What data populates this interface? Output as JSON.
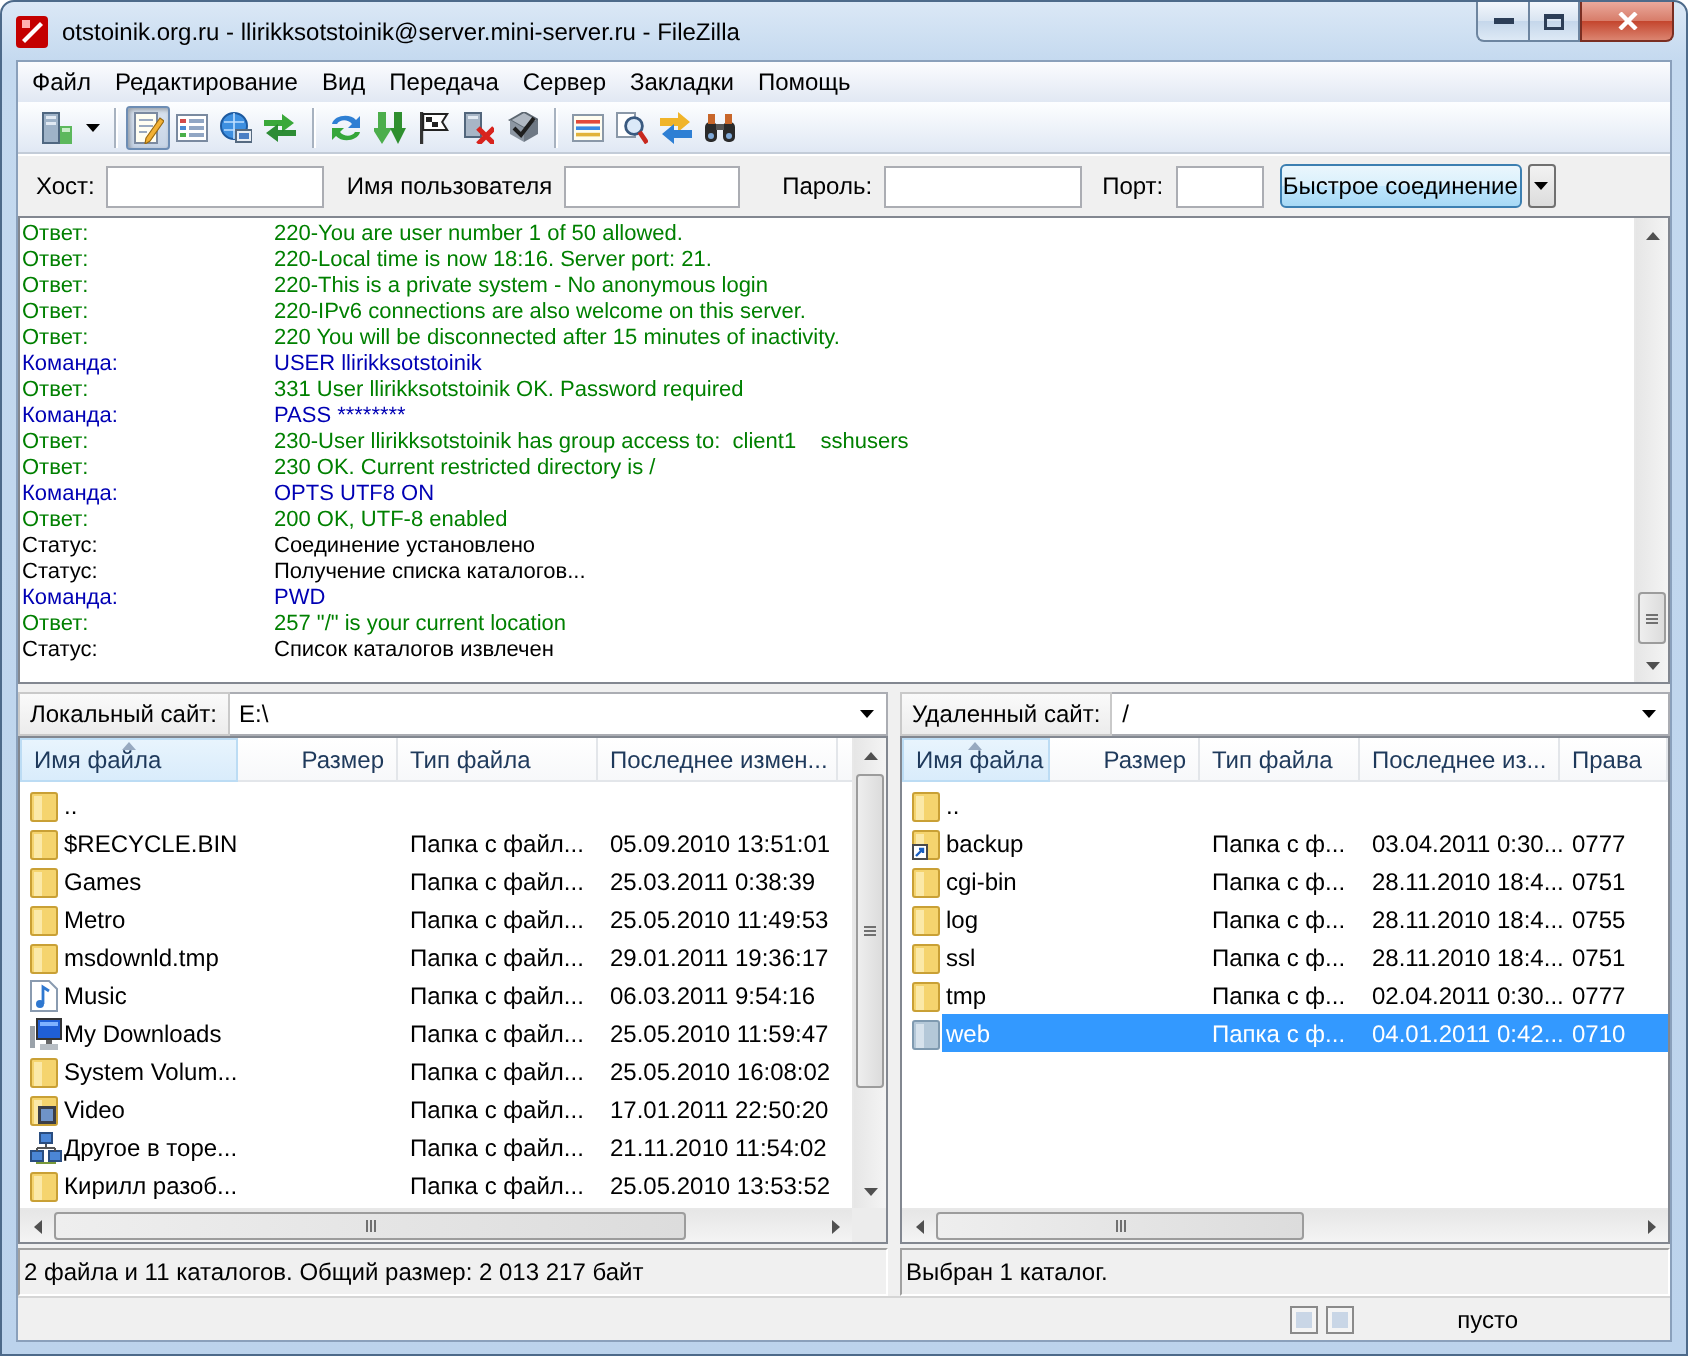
{
  "window": {
    "title": "otstoinik.org.ru - llirikksotstoinik@server.mini-server.ru - FileZilla"
  },
  "menu": [
    "Файл",
    "Редактирование",
    "Вид",
    "Передача",
    "Сервер",
    "Закладки",
    "Помощь"
  ],
  "toolbar": {
    "groups": [
      [
        {
          "kind": "site_manager",
          "pressed": false
        }
      ],
      [
        {
          "kind": "message_log",
          "pressed": true
        },
        {
          "kind": "local_tree",
          "pressed": false
        },
        {
          "kind": "remote_tree",
          "pressed": false
        },
        {
          "kind": "queue",
          "pressed": false
        }
      ],
      [
        {
          "kind": "refresh",
          "pressed": false
        },
        {
          "kind": "process_queue",
          "pressed": false
        },
        {
          "kind": "cancel",
          "pressed": false
        },
        {
          "kind": "disconnect",
          "pressed": false
        },
        {
          "kind": "reconnect",
          "pressed": false
        }
      ],
      [
        {
          "kind": "filter",
          "pressed": false
        },
        {
          "kind": "compare",
          "pressed": false
        },
        {
          "kind": "sync_browse",
          "pressed": false
        },
        {
          "kind": "search",
          "pressed": false
        }
      ]
    ]
  },
  "quickconnect": {
    "fields": [
      {
        "label": "Хост:"
      },
      {
        "label": "Имя пользователя"
      },
      {
        "label": "Пароль:"
      },
      {
        "label": "Порт:"
      }
    ],
    "button": "Быстрое соединение"
  },
  "log": [
    {
      "kind": "response",
      "label": "Ответ:",
      "message": "220-You are user number 1 of 50 allowed."
    },
    {
      "kind": "response",
      "label": "Ответ:",
      "message": "220-Local time is now 18:16. Server port: 21."
    },
    {
      "kind": "response",
      "label": "Ответ:",
      "message": "220-This is a private system - No anonymous login"
    },
    {
      "kind": "response",
      "label": "Ответ:",
      "message": "220-IPv6 connections are also welcome on this server."
    },
    {
      "kind": "response",
      "label": "Ответ:",
      "message": "220 You will be disconnected after 15 minutes of inactivity."
    },
    {
      "kind": "command",
      "label": "Команда:",
      "message": "USER llirikksotstoinik"
    },
    {
      "kind": "response",
      "label": "Ответ:",
      "message": "331 User llirikksotstoinik OK. Password required"
    },
    {
      "kind": "command",
      "label": "Команда:",
      "message": "PASS ********"
    },
    {
      "kind": "response",
      "label": "Ответ:",
      "message": "230-User llirikksotstoinik has group access to:  client1    sshusers"
    },
    {
      "kind": "response",
      "label": "Ответ:",
      "message": "230 OK. Current restricted directory is /"
    },
    {
      "kind": "command",
      "label": "Команда:",
      "message": "OPTS UTF8 ON"
    },
    {
      "kind": "response",
      "label": "Ответ:",
      "message": "200 OK, UTF-8 enabled"
    },
    {
      "kind": "status",
      "label": "Статус:",
      "message": "Соединение установлено"
    },
    {
      "kind": "status",
      "label": "Статус:",
      "message": "Получение списка каталогов..."
    },
    {
      "kind": "command",
      "label": "Команда:",
      "message": "PWD"
    },
    {
      "kind": "response",
      "label": "Ответ:",
      "message": "257 \"/\" is your current location"
    },
    {
      "kind": "status",
      "label": "Статус:",
      "message": "Список каталогов извлечен"
    }
  ],
  "local": {
    "site_label": "Локальный сайт:",
    "path": "E:\\",
    "columns": [
      {
        "label": "Имя файла",
        "sorted": true
      },
      {
        "label": "Размер",
        "sorted": false
      },
      {
        "label": "Тип файла",
        "sorted": false
      },
      {
        "label": "Последнее измен...",
        "sorted": false
      }
    ],
    "files": [
      {
        "kind": "folder",
        "name": "..",
        "selected": false
      },
      {
        "kind": "folder",
        "name": "$RECYCLE.BIN",
        "type": "Папка с файл...",
        "modified": "05.09.2010 13:51:01",
        "selected": false
      },
      {
        "kind": "folder",
        "name": "Games",
        "type": "Папка с файл...",
        "modified": "25.03.2011 0:38:39",
        "selected": false
      },
      {
        "kind": "folder",
        "name": "Metro",
        "type": "Папка с файл...",
        "modified": "25.05.2010 11:49:53",
        "selected": false
      },
      {
        "kind": "folder",
        "name": "msdownld.tmp",
        "type": "Папка с файл...",
        "modified": "29.01.2011 19:36:17",
        "selected": false
      },
      {
        "kind": "music",
        "name": "Music",
        "type": "Папка с файл...",
        "modified": "06.03.2011 9:54:16",
        "selected": false
      },
      {
        "kind": "computer",
        "name": "My Downloads",
        "type": "Папка с файл...",
        "modified": "25.05.2010 11:59:47",
        "selected": false
      },
      {
        "kind": "folder",
        "name": "System Volum...",
        "type": "Папка с файл...",
        "modified": "25.05.2010 16:08:02",
        "selected": false
      },
      {
        "kind": "video",
        "name": "Video",
        "type": "Папка с файл...",
        "modified": "17.01.2011 22:50:20",
        "selected": false
      },
      {
        "kind": "network",
        "name": "Другое в торе...",
        "type": "Папка с файл...",
        "modified": "21.11.2010 11:54:02",
        "selected": false
      },
      {
        "kind": "folder",
        "name": "Кирилл разоб...",
        "type": "Папка с файл...",
        "modified": "25.05.2010 13:53:52",
        "selected": false
      }
    ],
    "status": "2 файла и 11 каталогов. Общий размер: 2 013 217 байт"
  },
  "remote": {
    "site_label": "Удаленный сайт:",
    "path": "/",
    "columns": [
      {
        "label": "Имя файла",
        "sorted": true
      },
      {
        "label": "Размер",
        "sorted": false
      },
      {
        "label": "Тип файла",
        "sorted": false
      },
      {
        "label": "Последнее из...",
        "sorted": false
      },
      {
        "label": "Права",
        "sorted": false
      }
    ],
    "files": [
      {
        "kind": "folder",
        "name": "..",
        "selected": false
      },
      {
        "kind": "link",
        "name": "backup",
        "type": "Папка с ф...",
        "modified": "03.04.2011 0:30...",
        "permissions": "0777",
        "selected": false
      },
      {
        "kind": "folder",
        "name": "cgi-bin",
        "type": "Папка с ф...",
        "modified": "28.11.2010 18:4...",
        "permissions": "0751",
        "selected": false
      },
      {
        "kind": "folder",
        "name": "log",
        "type": "Папка с ф...",
        "modified": "28.11.2010 18:4...",
        "permissions": "0755",
        "selected": false
      },
      {
        "kind": "folder",
        "name": "ssl",
        "type": "Папка с ф...",
        "modified": "28.11.2010 18:4...",
        "permissions": "0751",
        "selected": false
      },
      {
        "kind": "folder",
        "name": "tmp",
        "type": "Папка с ф...",
        "modified": "02.04.2011 0:30...",
        "permissions": "0777",
        "selected": false
      },
      {
        "kind": "folder",
        "name": "web",
        "type": "Папка с ф...",
        "modified": "04.01.2011 0:42...",
        "permissions": "0710",
        "selected": true
      }
    ],
    "status": "Выбран 1 каталог."
  },
  "status_bar": {
    "queue": "пусто"
  }
}
